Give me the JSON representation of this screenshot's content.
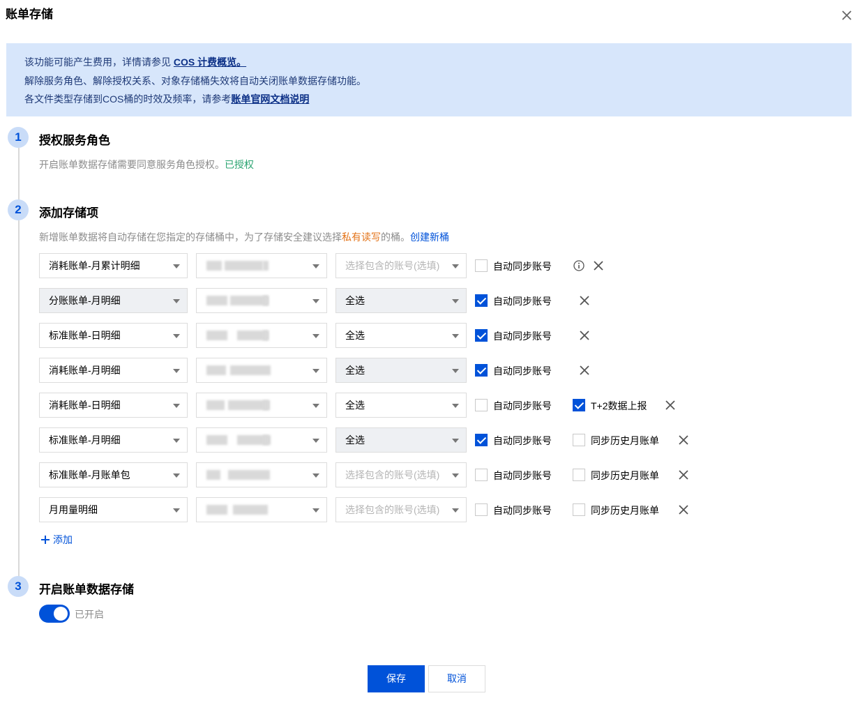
{
  "dialog": {
    "title": "账单存储"
  },
  "notice": {
    "line1_prefix": "该功能可能产生费用，详情请参见 ",
    "line1_link": "COS 计费概览。",
    "line2": "解除服务角色、解除授权关系、对象存储桶失效将自动关闭账单数据存储功能。",
    "line3_prefix": "各文件类型存储到COS桶的时效及频率，请参考",
    "line3_link": "账单官网文档说明"
  },
  "steps": [
    {
      "num": "1",
      "title": "授权服务角色",
      "desc": "开启账单数据存储需要同意服务角色授权。",
      "status": "已授权"
    },
    {
      "num": "2",
      "title": "添加存储项",
      "desc_prefix": "新增账单数据将自动存储在您指定的存储桶中，为了存储安全建议选择",
      "desc_highlight": "私有读写",
      "desc_suffix": "的桶。",
      "link": "创建新桶"
    },
    {
      "num": "3",
      "title": "开启账单数据存储",
      "toggle_label": "已开启"
    }
  ],
  "rows": [
    {
      "type": "消耗账单-月累计明细",
      "account": "选择包含的账号(选填)",
      "auto_sync": "自动同步账号"
    },
    {
      "type": "分账账单-月明细",
      "account": "全选",
      "auto_sync": "自动同步账号"
    },
    {
      "type": "标准账单-日明细",
      "account": "全选",
      "auto_sync": "自动同步账号"
    },
    {
      "type": "消耗账单-月明细",
      "account": "全选",
      "auto_sync": "自动同步账号"
    },
    {
      "type": "消耗账单-日明细",
      "account": "全选",
      "auto_sync": "自动同步账号",
      "extra": "T+2数据上报"
    },
    {
      "type": "标准账单-月明细",
      "account": "全选",
      "auto_sync": "自动同步账号",
      "extra": "同步历史月账单"
    },
    {
      "type": "标准账单-月账单包",
      "account": "选择包含的账号(选填)",
      "auto_sync": "自动同步账号",
      "extra": "同步历史月账单"
    },
    {
      "type": "月用量明细",
      "account": "选择包含的账号(选填)",
      "auto_sync": "自动同步账号",
      "extra": "同步历史月账单"
    }
  ],
  "add_label": "添加",
  "buttons": {
    "save": "保存",
    "cancel": "取消"
  },
  "colors": {
    "primary": "#0052d9",
    "success": "#2ba471",
    "warning": "#e37318",
    "notice_bg": "#d7e6fb"
  }
}
